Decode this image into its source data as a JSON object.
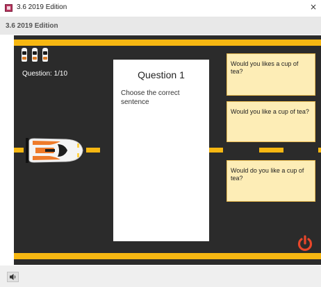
{
  "window": {
    "title": "3.6 2019 Edition",
    "close_glyph": "×",
    "app_icon": "app-icon"
  },
  "header": {
    "title": "3.6 2019 Edition"
  },
  "game": {
    "lives_remaining": 3,
    "question_counter": "Question: 1/10",
    "colors": {
      "road": "#2b2b2b",
      "stripe": "#f6b712",
      "answer_fill": "#fdedb6",
      "answer_border": "#e9b94f",
      "power_icon": "#e8462a",
      "car_accent": "#ee7a2a"
    }
  },
  "question": {
    "title": "Question 1",
    "prompt": "Choose the correct sentence"
  },
  "answers": [
    {
      "text": "Would you likes a cup of tea?"
    },
    {
      "text": "Would you like a cup of tea?"
    },
    {
      "text": "Would do you like a cup of tea?"
    }
  ],
  "controls": {
    "power_icon": "power-icon",
    "sound_icon": "speaker-icon"
  }
}
